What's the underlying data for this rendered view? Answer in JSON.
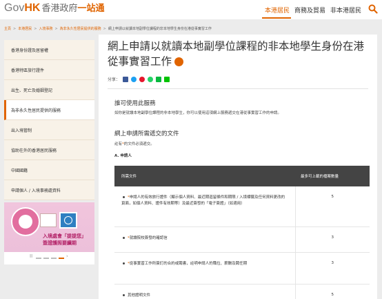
{
  "header": {
    "logo_gov": "Gov",
    "logo_hk": "HK",
    "logo_cn": "香港政府",
    "logo_stop": "一站通",
    "nav": [
      "本港居民",
      "商務及貿易",
      "非本港居民"
    ],
    "active_nav": "本港居民"
  },
  "breadcrumb": [
    "主頁",
    "本港居民",
    "入境事務",
    "為非永久性居民提供的服務",
    "網上申請以就讀本地副學位課程的非本地學生身份在港從事實習工作"
  ],
  "sidebar": {
    "items": [
      "香港身份證及居留權",
      "香港特區旅行證件",
      "出生、死亡及婚姻登記",
      "為非永久性居民提供的服務",
      "出入境管制",
      "協助在外的香港居民服務",
      "中國國籍",
      "申請個人 / 入境事務處資料"
    ],
    "active_index": 3,
    "banner_text_1": "入境處會「提提您」",
    "banner_text_2": "簽證護照要續期"
  },
  "main": {
    "title": "網上申請以就讀本地副學位課程的非本地學生身份在港從事實習工作",
    "share_label": "分享：",
    "share_icons": [
      "facebook-icon",
      "twitter-icon",
      "weibo-icon",
      "whatsapp-icon",
      "wechat-icon",
      "line-icon"
    ],
    "who_title": "誰可使用此服務",
    "who_text": "如你是就讀本地副學位課程的非本地學生，你可以使用這項網上服務遞交在港從事實習工作的申請。",
    "docs_title": "網上申請所需遞交的文件",
    "required_note_pre": "註有",
    "required_note_star": "*",
    "required_note_post": "的文件必須遞交。",
    "subhead": "A. 申請人",
    "table": {
      "headers": [
        "所需文件",
        "最多可上載的檔案數量"
      ],
      "rows": [
        {
          "req": true,
          "text": "申請人的有效旅行證件（顯示個人資料、最近期逗留條件和期限 / 入境標籤及任何資料更改的頁面，如個人資料、證件有效期等）及最近簽發的「電子簽證」（如適用）",
          "count": "5"
        },
        {
          "req": true,
          "text": "就讀院校簽發的確認信",
          "count": "3"
        },
        {
          "req": true,
          "text": "從事實習工作所簽訂的合約或聘書，註明申請人的職位、薪酬及聘任期",
          "count": "3"
        },
        {
          "req": false,
          "text": "其他證明文件",
          "count": "5"
        }
      ]
    }
  },
  "colors": {
    "accent": "#e06400",
    "sidebar_bg": "#f8f2e8",
    "table_header": "#444444"
  }
}
